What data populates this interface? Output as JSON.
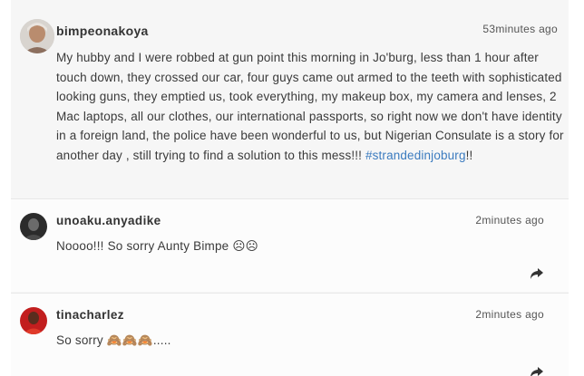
{
  "post": {
    "username": "bimpeonakoya",
    "time": "53minutes ago",
    "text": "My hubby and I were robbed at gun point this morning in Jo'burg, less than 1 hour after touch down, they crossed our car, four guys came out armed to the teeth with sophisticated looking guns, they emptied us, took everything, my makeup box, my camera and lenses, 2 Mac laptops, all our clothes, our international passports, so right now we don't have identity in a foreign land, the police have been wonderful to us, but Nigerian Consulate is a story for another day , still trying to find a solution to this mess!!! ",
    "hashtag": "#strandedinjoburg",
    "text_end": "!!"
  },
  "comments": [
    {
      "username": "unoaku.anyadike",
      "time": "2minutes ago",
      "text": "Noooo!!! So sorry Aunty Bimpe ☹☹",
      "share_icon": "reply-arrow-icon"
    },
    {
      "username": "tinacharlez",
      "time": "2minutes ago",
      "text": "So sorry 🙈🙈🙈.....",
      "share_icon": "reply-arrow-icon"
    }
  ],
  "colors": {
    "hashtag": "#3b7bbf",
    "panel_bg": "#f6f6f6",
    "comment_bg": "#fcfcfc"
  }
}
